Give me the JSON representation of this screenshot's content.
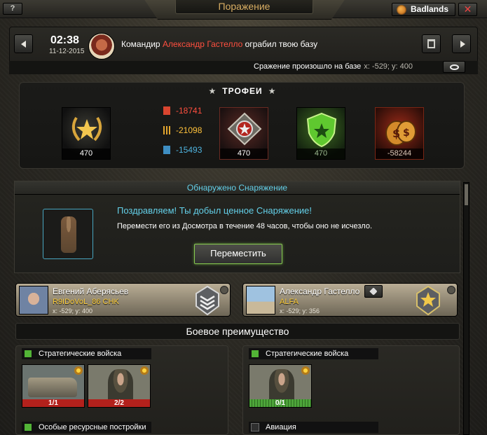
{
  "header": {
    "help_label": "?",
    "title": "Поражение",
    "server_label": "Badlands",
    "close_label": "✕"
  },
  "message": {
    "time": "02:38",
    "date": "11-12-2015",
    "text_prefix": "Командир",
    "attacker_name": "Александр Гастелло",
    "text_suffix": "ограбил твою базу",
    "battle_location_label": "Сражение произошло на базе",
    "battle_coords": "x: -529; y: 400"
  },
  "trophies": {
    "title": "ТРОФЕИ",
    "medal_value": "470",
    "resources": [
      {
        "name": "fuel",
        "value": "-18741",
        "color": "#ff4f3f",
        "icon": "fuel-icon"
      },
      {
        "name": "ammo",
        "value": "-21098",
        "color": "#ffc23b",
        "icon": "ammo-icon"
      },
      {
        "name": "metal",
        "value": "-15493",
        "color": "#4fb4e0",
        "icon": "metal-icon"
      }
    ],
    "rank_value": "470",
    "shield_value": "470",
    "money_value": "-58244"
  },
  "equipment": {
    "header": "Обнаружено Снаряжение",
    "congrats": "Поздравляем! Ты добыл ценное Снаряжение!",
    "description": "Перемести его из Досмотра в течение 48 часов, чтобы оно не исчезло.",
    "move_button": "Переместить"
  },
  "players": {
    "defender": {
      "name": "Евгений Аберясьев",
      "alliance": "R9IDoVoL_86 CHK",
      "coords": "x: -529; y: 400"
    },
    "attacker": {
      "name": "Александр Гастелло",
      "alliance": "ALFA",
      "coords": "x: -529; y: 356"
    }
  },
  "advantage": {
    "title": "Боевое преимущество",
    "left": {
      "category1": "Стратегические войска",
      "units": [
        {
          "type": "tank",
          "count": "1/1"
        },
        {
          "type": "soldier",
          "count": "2/2"
        }
      ],
      "category2": "Особые ресурсные постройки"
    },
    "right": {
      "category1": "Стратегические войска",
      "units": [
        {
          "type": "soldier",
          "count": "0/1"
        }
      ],
      "category2": "Авиация"
    }
  }
}
